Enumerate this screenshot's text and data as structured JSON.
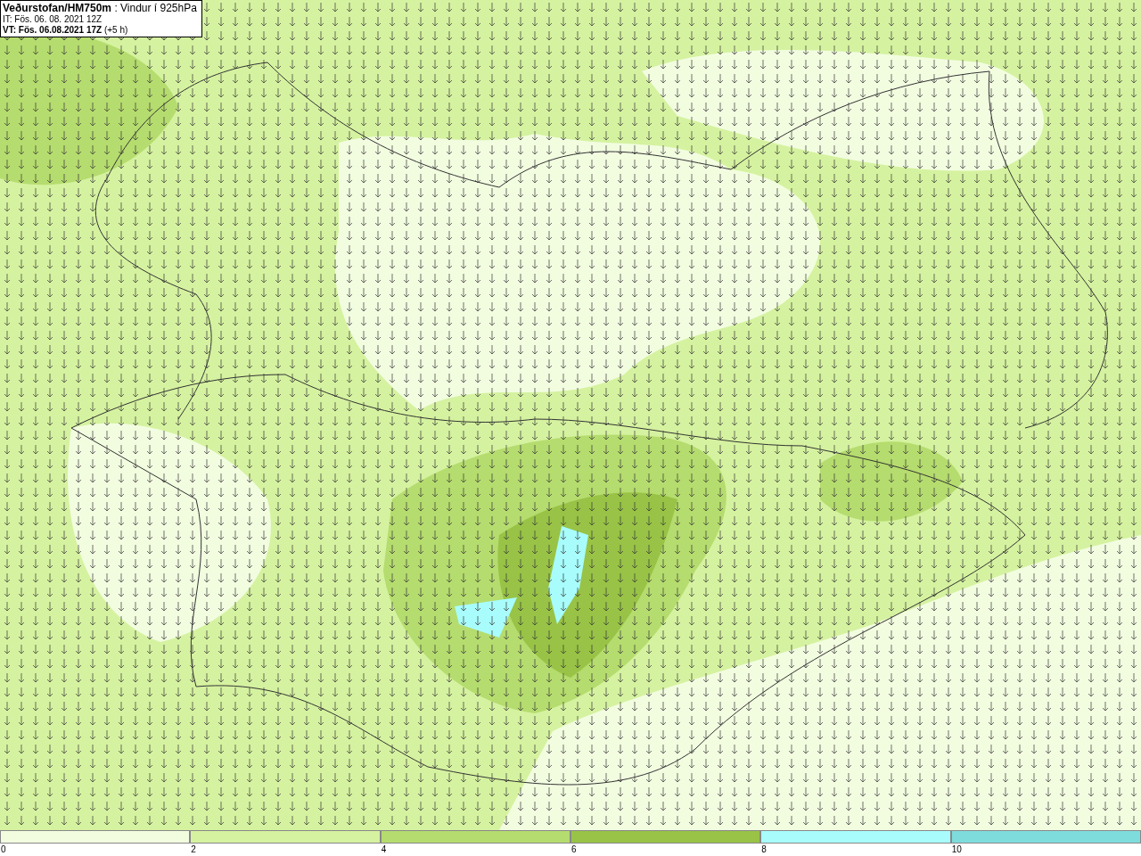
{
  "header": {
    "lines": [
      "**Veðurstofan/HM750m** : Vindur í 925hPa",
      "IT: Fös. 06. 08. 2021 12Z",
      "**VT: Fös. 06.08.2021 17Z** (+5 h)"
    ]
  },
  "legend": {
    "segments": [
      {
        "color": "#f2fde0",
        "label": "0"
      },
      {
        "color": "#d5f2a0",
        "label": "2"
      },
      {
        "color": "#b5dc6e",
        "label": "4"
      },
      {
        "color": "#98c346",
        "label": "6"
      },
      {
        "color": "#a8fcfc",
        "label": "8"
      },
      {
        "color": "#7fdcdc",
        "label": "10"
      }
    ]
  }
}
